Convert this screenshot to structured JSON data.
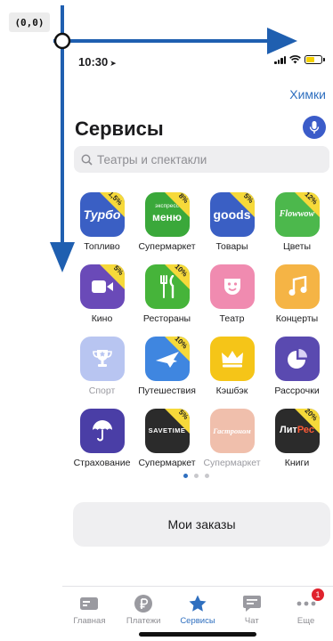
{
  "origin_label": "(0,0)",
  "status": {
    "time": "10:30",
    "location_arrow": "➤"
  },
  "header": {
    "city": "Химки",
    "title": "Сервисы"
  },
  "search": {
    "placeholder": "Театры и спектакли"
  },
  "services": [
    {
      "label": "Топливо",
      "icon": "turbo-logo-icon",
      "icon_text": "Турбо",
      "badge": "1,5%",
      "color": "#3a5fc4"
    },
    {
      "label": "Супермаркет",
      "icon": "express-menu-logo-icon",
      "icon_text": "меню",
      "icon_subtext": "экспресс",
      "badge": "8%",
      "color": "#3aa83a"
    },
    {
      "label": "Товары",
      "icon": "goods-logo-icon",
      "icon_text": "goods",
      "badge": "5%",
      "color": "#3a5fc4"
    },
    {
      "label": "Цветы",
      "icon": "flowwow-logo-icon",
      "icon_text": "Flowwow",
      "badge": "12%",
      "color": "#4cb84c"
    },
    {
      "label": "Кино",
      "icon": "video-camera-icon",
      "icon_text": "",
      "badge": "5%",
      "color": "#6a4ab8"
    },
    {
      "label": "Рестораны",
      "icon": "fork-knife-icon",
      "icon_text": "",
      "badge": "10%",
      "color": "#46b43a"
    },
    {
      "label": "Театр",
      "icon": "theatre-mask-icon",
      "icon_text": "",
      "badge": "",
      "color": "#f08bb0"
    },
    {
      "label": "Концерты",
      "icon": "music-note-icon",
      "icon_text": "",
      "badge": "",
      "color": "#f5b445"
    },
    {
      "label": "Спорт",
      "icon": "trophy-icon",
      "icon_text": "",
      "badge": "",
      "color": "#7f97e6",
      "dimmed": true
    },
    {
      "label": "Путешествия",
      "icon": "airplane-icon",
      "icon_text": "",
      "badge": "10%",
      "color": "#3f86e0"
    },
    {
      "label": "Кэшбэк",
      "icon": "crown-icon",
      "icon_text": "",
      "badge": "",
      "color": "#f5c518"
    },
    {
      "label": "Рассрочки",
      "icon": "pie-chart-icon",
      "icon_text": "",
      "badge": "",
      "color": "#5a4ab0"
    },
    {
      "label": "Страхование",
      "icon": "umbrella-icon",
      "icon_text": "",
      "badge": "",
      "color": "#4a3ea6"
    },
    {
      "label": "Супермаркет",
      "icon": "savetime-logo-icon",
      "icon_text": "SAVETIME",
      "badge": "5%",
      "color": "#2b2b2b"
    },
    {
      "label": "Супермаркет",
      "icon": "gastronom-logo-icon",
      "icon_text": "Гастроном",
      "badge": "",
      "color": "#e58c6a",
      "dimmed": true
    },
    {
      "label": "Книги",
      "icon": "litres-logo-icon",
      "icon_text": "ЛитРес",
      "badge": "20%",
      "color": "#2b2b2b"
    }
  ],
  "pager": {
    "pages": 3,
    "active": 1
  },
  "orders_button": "Мои заказы",
  "tabs": [
    {
      "label": "Главная",
      "icon": "card-icon",
      "active": false
    },
    {
      "label": "Платежи",
      "icon": "ruble-icon",
      "active": false
    },
    {
      "label": "Сервисы",
      "icon": "star-icon",
      "active": true
    },
    {
      "label": "Чат",
      "icon": "chat-icon",
      "active": false
    },
    {
      "label": "Еще",
      "icon": "more-dots-icon",
      "active": false,
      "badge": "1"
    }
  ],
  "colors": {
    "accent": "#2f6fbf",
    "mic": "#3b5cc9",
    "badge": "#f6d93a",
    "axis": "#1f5fb0"
  }
}
